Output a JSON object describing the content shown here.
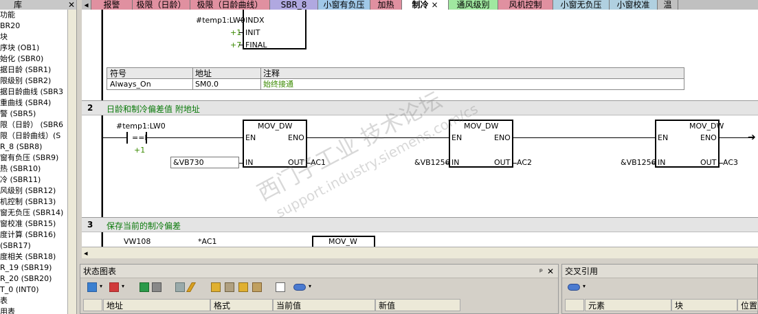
{
  "tree": {
    "title": "库",
    "close_label": "✕",
    "items": [
      "功能",
      "BR20",
      "块",
      "序块 (OB1)",
      "始化 (SBR0)",
      "据日龄 (SBR1)",
      "限级别 (SBR2)",
      "据日龄曲线 (SBR3",
      "重曲线 (SBR4)",
      "警 (SBR5)",
      "限（日龄） (SBR6",
      "限（日龄曲线）(S",
      "R_8 (SBR8)",
      "窗有负压 (SBR9)",
      "热 (SBR10)",
      "冷 (SBR11)",
      "风级别 (SBR12)",
      "机控制 (SBR13)",
      "窗无负压 (SBR14)",
      "窗校准 (SBR15)",
      "度计算 (SBR16)",
      "(SBR17)",
      "度相关 (SBR18)",
      "R_19 (SBR19)",
      "R_20 (SBR20)",
      "T_0 (INT0)",
      "表",
      "用表"
    ]
  },
  "tabs": [
    "报警",
    "极限（日龄）",
    "极限（日龄曲线）",
    "SBR_8",
    "小窗有负压",
    "加热",
    "制冷",
    "通风级别",
    "风机控制",
    "小窗无负压",
    "小窗校准",
    "温"
  ],
  "active_tab": "制冷",
  "tab_close": "×",
  "net1": {
    "param1": "#temp1:LW0",
    "pin1": "INDX",
    "param2": "+1",
    "pin2": "INIT",
    "param3": "+7",
    "pin3": "FINAL"
  },
  "symtable": {
    "headers": [
      "符号",
      "地址",
      "注释"
    ],
    "row": [
      "Always_On",
      "SM0.0",
      "始终接通"
    ]
  },
  "net2": {
    "number": "2",
    "comment": "日龄和制冷偏差值 附地址",
    "contact_addr": "#temp1:LW0",
    "contact_op": "==I",
    "contact_val": "+1",
    "boxes": [
      {
        "title": "MOV_DW",
        "en": "EN",
        "eno": "ENO",
        "in": "IN",
        "out": "OUT",
        "in_val": "&VB730",
        "out_val": "AC1"
      },
      {
        "title": "MOV_DW",
        "en": "EN",
        "eno": "ENO",
        "in": "IN",
        "out": "OUT",
        "in_val": "&VB1256",
        "out_val": "AC2"
      },
      {
        "title": "MOV_DW",
        "en": "EN",
        "eno": "ENO",
        "in": "IN",
        "out": "OUT",
        "in_val": "&VB1256",
        "out_val": "AC3"
      }
    ]
  },
  "net3": {
    "number": "3",
    "comment": "保存当前的制冷偏差",
    "op1": "VW108",
    "op2": "*AC1",
    "box_title": "MOV_W"
  },
  "watermark": {
    "line1": "西门子工业  技术论坛",
    "line2": "support.industry.siemens.com/cs"
  },
  "status_panel": {
    "title": "状态图表",
    "pin": "ᵖ",
    "close": "✕",
    "columns": [
      "地址",
      "格式",
      "当前值",
      "新值"
    ]
  },
  "xref_panel": {
    "title": "交叉引用",
    "columns": [
      "元素",
      "块",
      "位置"
    ]
  }
}
